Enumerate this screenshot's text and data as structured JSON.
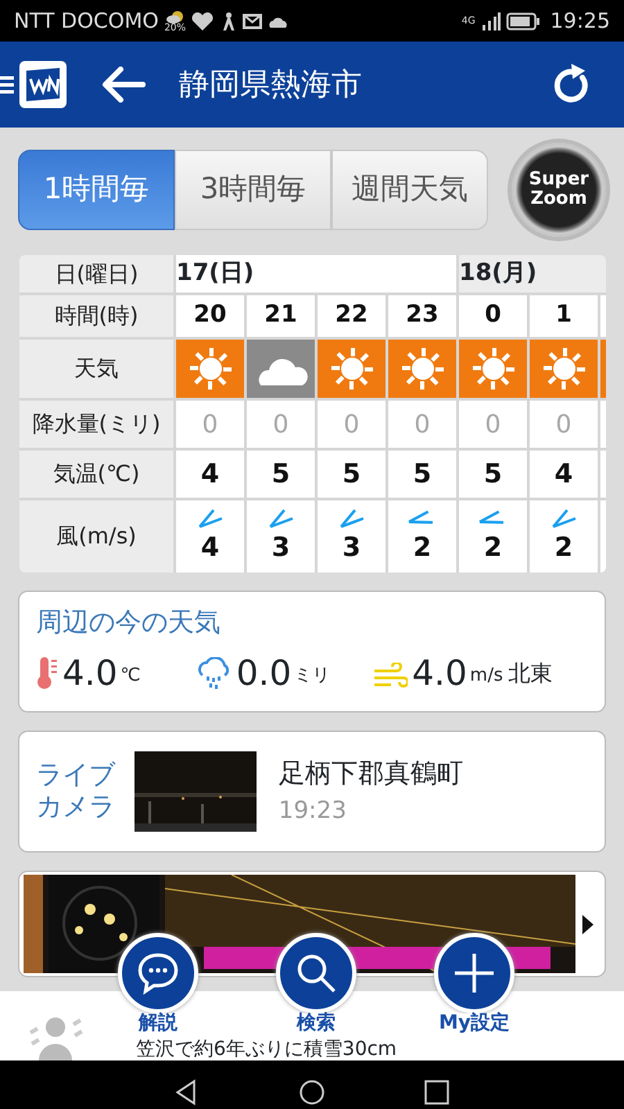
{
  "status_bar": {
    "carrier": "NTT DOCOMO",
    "rain_chance": "20%",
    "network": "4G",
    "time": "19:25"
  },
  "app_bar": {
    "title": "静岡県熱海市"
  },
  "tabs": [
    {
      "label": "1時間毎",
      "selected": true
    },
    {
      "label": "3時間毎",
      "selected": false
    },
    {
      "label": "週間天気",
      "selected": false
    }
  ],
  "super_zoom": {
    "line_1": "Super",
    "line_2": "Zoom"
  },
  "forecast": {
    "labels": {
      "date": "日(曜日)",
      "hour": "時間(時)",
      "weather": "天気",
      "precip": "降水量(ミリ)",
      "temp": "気温(℃)",
      "wind": "風(m/s)"
    },
    "dates": [
      {
        "text": "17(日)",
        "selected": false
      },
      {
        "text": "18(月)",
        "selected": true
      }
    ],
    "columns": [
      {
        "hour": "20",
        "weather": {
          "kind": "sunny"
        },
        "precip": "0",
        "temp": "4",
        "wind": "4",
        "wind_arrow": {
          "kind": "steep"
        }
      },
      {
        "hour": "21",
        "weather": {
          "kind": "cloudy"
        },
        "precip": "0",
        "temp": "5",
        "wind": "3",
        "wind_arrow": {
          "kind": "steep"
        }
      },
      {
        "hour": "22",
        "weather": {
          "kind": "sunny"
        },
        "precip": "0",
        "temp": "5",
        "wind": "3",
        "wind_arrow": {
          "kind": "steep"
        }
      },
      {
        "hour": "23",
        "weather": {
          "kind": "sunny"
        },
        "precip": "0",
        "temp": "5",
        "wind": "2",
        "wind_arrow": {
          "kind": "flat"
        }
      },
      {
        "hour": "0",
        "weather": {
          "kind": "sunny"
        },
        "precip": "0",
        "temp": "5",
        "wind": "2",
        "wind_arrow": {
          "kind": "flat"
        }
      },
      {
        "hour": "1",
        "weather": {
          "kind": "sunny"
        },
        "precip": "0",
        "temp": "4",
        "wind": "2",
        "wind_arrow": {
          "kind": "steep"
        }
      }
    ],
    "partial_weather": {
      "kind": "sunny"
    }
  },
  "nearby": {
    "title": "周辺の今の天気",
    "temp": "4.0",
    "temp_unit": "℃",
    "rain": "0.0",
    "rain_unit": "ミリ",
    "wind": "4.0",
    "wind_unit": "m/s",
    "wind_dir": "北東"
  },
  "live_camera": {
    "label": "ライブカメラ",
    "place": "足柄下郡真鶴町",
    "time": "19:23"
  },
  "fabs": [
    {
      "kind": "comment",
      "label": "解説"
    },
    {
      "kind": "search",
      "label": "検索"
    },
    {
      "kind": "add",
      "label": "My設定"
    }
  ],
  "ticker": "笠沢で約6年ぶりに積雪30cm"
}
